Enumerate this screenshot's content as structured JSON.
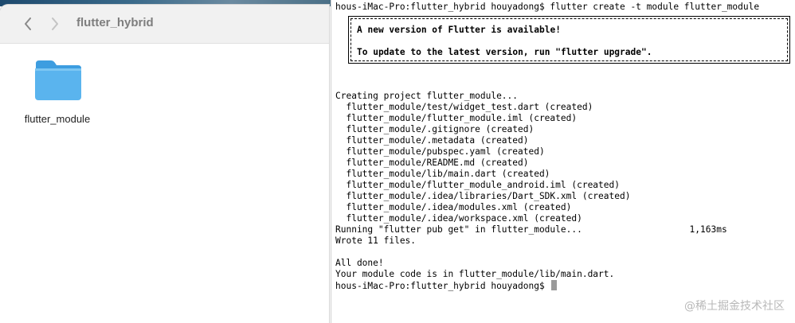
{
  "finder": {
    "title": "flutter_hybrid",
    "items": [
      {
        "label": "flutter_module",
        "icon": "folder-icon"
      }
    ]
  },
  "terminal": {
    "command_line": "hous-iMac-Pro:flutter_hybrid houyadong$ flutter create -t module flutter_module",
    "banner": {
      "line1": "A new version of Flutter is available!",
      "line2": "To update to the latest version, run \"flutter upgrade\"."
    },
    "output_lines": [
      "Creating project flutter_module...",
      "  flutter_module/test/widget_test.dart (created)",
      "  flutter_module/flutter_module.iml (created)",
      "  flutter_module/.gitignore (created)",
      "  flutter_module/.metadata (created)",
      "  flutter_module/pubspec.yaml (created)",
      "  flutter_module/README.md (created)",
      "  flutter_module/lib/main.dart (created)",
      "  flutter_module/flutter_module_android.iml (created)",
      "  flutter_module/.idea/libraries/Dart_SDK.xml (created)",
      "  flutter_module/.idea/modules.xml (created)",
      "  flutter_module/.idea/workspace.xml (created)",
      "Running \"flutter pub get\" in flutter_module...                    1,163ms",
      "Wrote 11 files.",
      "",
      "All done!",
      "Your module code is in flutter_module/lib/main.dart."
    ],
    "prompt": "hous-iMac-Pro:flutter_hybrid houyadong$"
  },
  "watermark": "@稀土掘金技术社区",
  "colors": {
    "folder": "#5ab4ee",
    "folder_tab": "#3d9de0",
    "cursor": "#9a9a9a"
  }
}
